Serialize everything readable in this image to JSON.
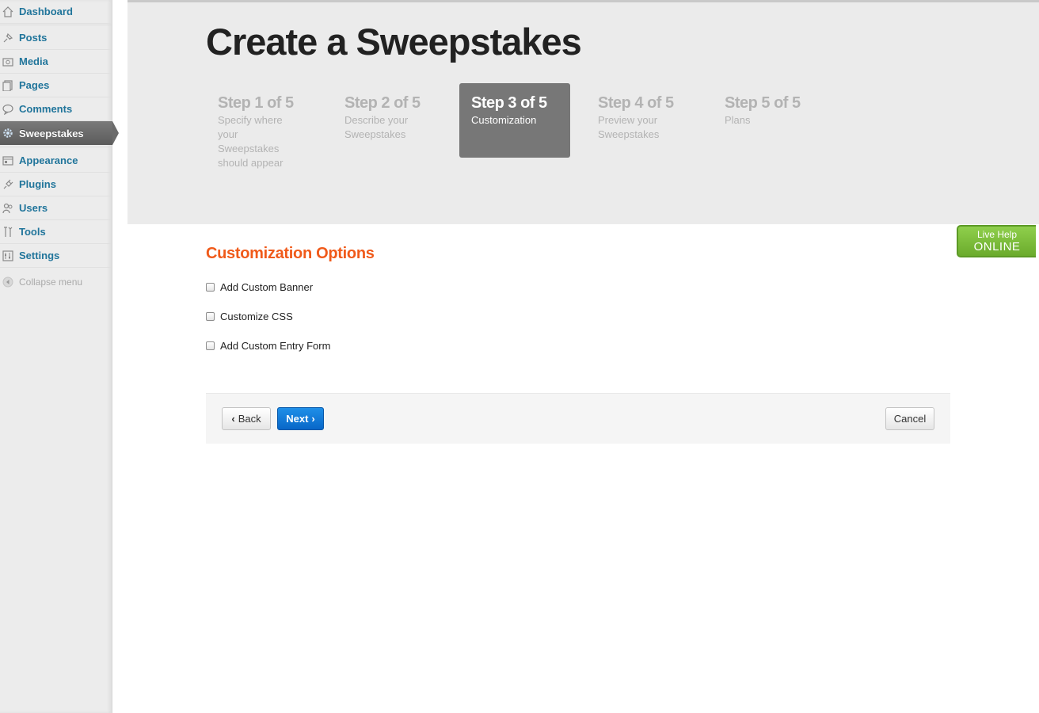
{
  "sidebar": {
    "items": [
      {
        "label": "Dashboard",
        "icon": "dashboard-icon"
      },
      {
        "label": "Posts",
        "icon": "pin-icon"
      },
      {
        "label": "Media",
        "icon": "media-icon"
      },
      {
        "label": "Pages",
        "icon": "pages-icon"
      },
      {
        "label": "Comments",
        "icon": "comment-icon"
      },
      {
        "label": "Sweepstakes",
        "icon": "gear-icon",
        "active": true
      },
      {
        "label": "Appearance",
        "icon": "appearance-icon"
      },
      {
        "label": "Plugins",
        "icon": "plug-icon"
      },
      {
        "label": "Users",
        "icon": "users-icon"
      },
      {
        "label": "Tools",
        "icon": "tools-icon"
      },
      {
        "label": "Settings",
        "icon": "settings-icon"
      }
    ],
    "collapse_label": "Collapse menu"
  },
  "header": {
    "title": "Create a Sweepstakes",
    "steps": [
      {
        "title": "Step 1 of 5",
        "description": "Specify where your Sweepstakes should appear"
      },
      {
        "title": "Step 2 of 5",
        "description": "Describe your Sweepstakes"
      },
      {
        "title": "Step 3 of 5",
        "description": "Customization",
        "active": true
      },
      {
        "title": "Step 4 of 5",
        "description": "Preview your Sweepstakes"
      },
      {
        "title": "Step 5 of 5",
        "description": "Plans"
      }
    ]
  },
  "live_help": {
    "line1": "Live Help",
    "line2": "ONLINE"
  },
  "main": {
    "section_title": "Customization Options",
    "options": [
      {
        "label": "Add Custom Banner",
        "checked": false
      },
      {
        "label": "Customize CSS",
        "checked": false
      },
      {
        "label": "Add Custom Entry Form",
        "checked": false
      }
    ]
  },
  "actions": {
    "back_label": "Back",
    "next_label": "Next",
    "cancel_label": "Cancel"
  },
  "colors": {
    "accent_orange": "#f05a1a",
    "primary_blue": "#0a74d9",
    "live_help_green": "#7dbd3c",
    "link_blue": "#21759b"
  }
}
